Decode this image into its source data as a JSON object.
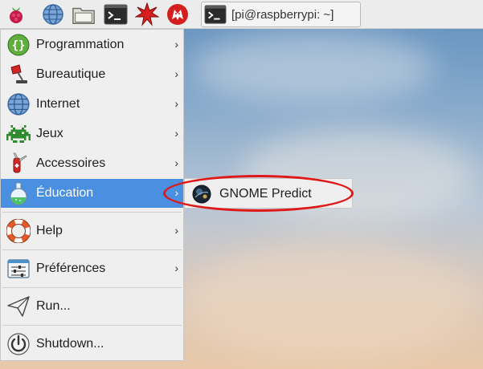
{
  "panel": {
    "launchers": [
      {
        "icon": "raspberry-pi-menu-icon"
      },
      {
        "icon": "globe-browser-icon"
      },
      {
        "icon": "folder-icon"
      },
      {
        "icon": "terminal-icon"
      },
      {
        "icon": "math-starburst-icon"
      },
      {
        "icon": "wolfram-icon"
      }
    ],
    "task_button": {
      "icon": "terminal-icon",
      "label": "[pi@raspberrypi: ~]"
    }
  },
  "menu": {
    "items": [
      {
        "label": "Programmation",
        "icon": "programming-icon",
        "has_submenu": true
      },
      {
        "label": "Bureautique",
        "icon": "lamp-icon",
        "has_submenu": true
      },
      {
        "label": "Internet",
        "icon": "globe-icon",
        "has_submenu": true
      },
      {
        "label": "Jeux",
        "icon": "space-invader-icon",
        "has_submenu": true
      },
      {
        "label": "Accessoires",
        "icon": "swiss-knife-icon",
        "has_submenu": true
      },
      {
        "label": "Éducation",
        "icon": "flask-icon",
        "has_submenu": true,
        "active": true
      },
      {
        "label": "Help",
        "icon": "lifebuoy-icon",
        "has_submenu": true
      },
      {
        "label": "Préférences",
        "icon": "preferences-icon",
        "has_submenu": true
      },
      {
        "label": "Run...",
        "icon": "paper-plane-icon",
        "has_submenu": false
      },
      {
        "label": "Shutdown...",
        "icon": "power-icon",
        "has_submenu": false
      }
    ],
    "arrow_glyph": "›"
  },
  "submenu": {
    "items": [
      {
        "label": "GNOME Predict",
        "icon": "gnome-predict-icon"
      }
    ]
  },
  "colors": {
    "active": "#4a8fe0",
    "annotation_ring": "#e01818"
  }
}
